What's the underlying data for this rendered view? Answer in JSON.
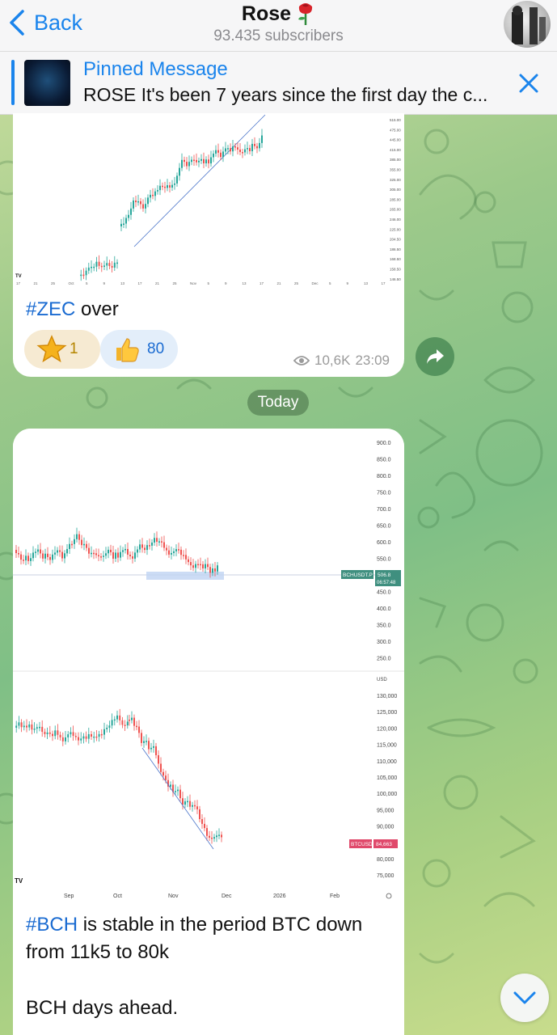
{
  "header": {
    "back_label": "Back",
    "channel_name": "Rose",
    "subscribers": "93.435 subscribers"
  },
  "pinned": {
    "title": "Pinned Message",
    "text": "ROSE It's been 7 years since the first day the c..."
  },
  "post1": {
    "hashtag": "#ZEC",
    "text_rest": " over",
    "reactions": [
      {
        "icon": "star-icon",
        "count": "1"
      },
      {
        "icon": "thumbs-up-icon",
        "count": "80"
      }
    ],
    "views": "10,6K",
    "time": "23:09",
    "chart_y_labels": [
      "515.00",
      "475.00",
      "445.00",
      "415.00",
      "385.00",
      "355.00",
      "325.00",
      "305.00",
      "285.00",
      "265.00",
      "246.00",
      "225.00",
      "204.50",
      "186.50",
      "168.50",
      "158.50",
      "146.50"
    ],
    "chart_x_labels": [
      "17",
      "21",
      "25",
      "Oct",
      "5",
      "9",
      "13",
      "17",
      "21",
      "25",
      "Nov",
      "5",
      "9",
      "13",
      "17",
      "21",
      "25",
      "Dec",
      "5",
      "9",
      "13",
      "17"
    ]
  },
  "date_separator": "Today",
  "post2": {
    "hashtag": "#BCH",
    "line1_rest": " is stable in the period BTC down",
    "line2": "from 11k5 to 80k",
    "line3": "BCH days ahead.",
    "chart_top": {
      "y_labels": [
        "900.0",
        "850.0",
        "800.0",
        "750.0",
        "700.0",
        "650.0",
        "600.0",
        "550.0",
        "500.0",
        "450.0",
        "400.0",
        "350.0",
        "300.0",
        "250.0"
      ],
      "symbol_tag": "BCHUSDT.P",
      "price_tag": "506.8",
      "countdown_tag": "06:57:48"
    },
    "chart_bottom": {
      "currency": "USD",
      "y_labels": [
        "130,000",
        "125,000",
        "120,000",
        "115,000",
        "110,000",
        "105,000",
        "100,000",
        "95,000",
        "90,000",
        "85,000",
        "80,000",
        "75,000"
      ],
      "symbol_tag": "BTCUSD",
      "price_tag": "84,663",
      "x_labels": [
        "Sep",
        "Oct",
        "Nov",
        "Dec",
        "2026",
        "Feb"
      ]
    }
  },
  "colors": {
    "accent": "#1a84ec",
    "hashtag": "#1a6bd1",
    "candle_up": "#26a69a",
    "candle_down": "#ef5350",
    "bch_tag": "#3f8f7f",
    "btc_tag": "#e0496b"
  }
}
